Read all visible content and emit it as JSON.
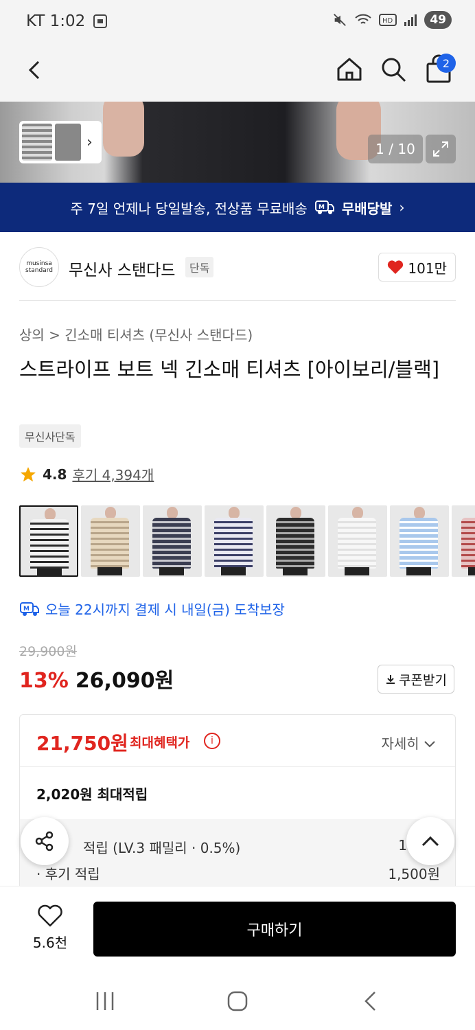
{
  "status_bar": {
    "carrier_time": "KT 1:02",
    "battery": "49"
  },
  "top_nav": {
    "cart_count": "2"
  },
  "hero": {
    "counter": "1 / 10"
  },
  "banner": {
    "text": "주 7일 언제나 당일발송, 전상품 무료배송",
    "badge": "무배당발",
    "chevron": "›"
  },
  "brand": {
    "logo_text": "musinsa standard",
    "name": "무신사 스탠다드",
    "tag": "단독",
    "likes": "101만"
  },
  "breadcrumb": "상의 > 긴소매 티셔츠 (무신사 스탠다드)",
  "product": {
    "title": "스트라이프 보트 넥 긴소매 티셔츠 [아이보리/블랙]",
    "tag": "무신사단독",
    "rating": "4.8",
    "reviews": "후기 4,394개"
  },
  "swatches": [
    {
      "color": "#f2f2f2",
      "stripe": "#2b2b2b"
    },
    {
      "color": "#e7d8bf",
      "stripe": "#b8a58a"
    },
    {
      "color": "#3b3e52",
      "stripe": "#c9c9cf"
    },
    {
      "color": "#e9e9f2",
      "stripe": "#3b3f66"
    },
    {
      "color": "#2c2c2c",
      "stripe": "#a9a9a9"
    },
    {
      "color": "#f7f7f7",
      "stripe": "#e1e1e1"
    },
    {
      "color": "#a9c8ec",
      "stripe": "#ffffff"
    },
    {
      "color": "#e6c2c2",
      "stripe": "#b34a4a"
    }
  ],
  "delivery": "오늘 22시까지 결제 시 내일(금) 도착보장",
  "pricing": {
    "original": "29,900원",
    "discount": "13%",
    "price": "26,090원",
    "coupon": "쿠폰받기"
  },
  "benefit": {
    "max_price": "21,750원",
    "max_label": "최대혜택가",
    "detail": "자세히",
    "points": "2,020원 최대적립",
    "sub1_label": "적립 (LV.3 패밀리 · 0.5%)",
    "sub1_value": "1",
    "sub2_label": "· 후기 적립",
    "sub2_value": "1,500원"
  },
  "bottom": {
    "wish_count": "5.6천",
    "buy": "구매하기"
  },
  "colors": {
    "accent_blue": "#1f63e8",
    "sale_red": "#e0251f",
    "banner_navy": "#0d2a7b"
  }
}
